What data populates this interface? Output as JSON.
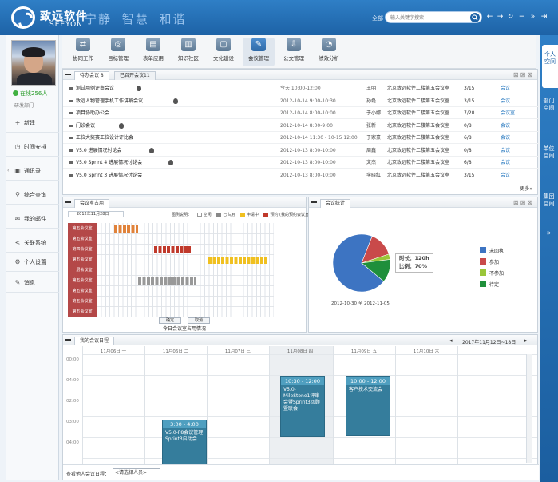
{
  "header": {
    "brand_cn": "致远软件",
    "brand_en": "SEEYON",
    "slogan": "宁静 智慧 和谐",
    "search_label": "全部",
    "search_placeholder": "输入关键字搜索"
  },
  "sidebar": {
    "online_text": "在线256人",
    "dept_text": "研发部门",
    "items": [
      {
        "icon": "plus-icon",
        "label": "新建"
      },
      {
        "icon": "clock-icon",
        "label": "时间安排"
      },
      {
        "icon": "contacts-icon",
        "label": "通讯录"
      },
      {
        "icon": "search-icon",
        "label": "综合查询"
      },
      {
        "icon": "mail-icon",
        "label": "我的邮件"
      },
      {
        "icon": "share-icon",
        "label": "关联系统"
      },
      {
        "icon": "settings-icon",
        "label": "个人设置"
      },
      {
        "icon": "message-icon",
        "label": "消息"
      }
    ]
  },
  "toolbar": {
    "items": [
      {
        "icon": "collaboration-icon",
        "label": "协同工作"
      },
      {
        "icon": "target-icon",
        "label": "目标管理"
      },
      {
        "icon": "form-icon",
        "label": "表单应用"
      },
      {
        "icon": "book-icon",
        "label": "知识社区"
      },
      {
        "icon": "clipboard-icon",
        "label": "文化建设"
      },
      {
        "icon": "meeting-icon",
        "label": "会议管理"
      },
      {
        "icon": "document-icon",
        "label": "公文管理"
      },
      {
        "icon": "analysis-icon",
        "label": "绩效分析"
      }
    ]
  },
  "vtabs": {
    "items": [
      "个人空间",
      "部门空间",
      "单位空间",
      "集团空间"
    ],
    "more": "»"
  },
  "meetings": {
    "tabs": [
      "待办会议 8",
      "已召开会议11"
    ],
    "rows": [
      {
        "title": "测试用例评审会议",
        "time": "今天 10:00-12:00",
        "host": "王明",
        "room": "北京致远软件二楼第五会议室",
        "count": "3/15",
        "type": "会议"
      },
      {
        "title": "致远人物管理手机工作讲解会议",
        "time": "2012-10-14 9:00-10:30",
        "host": "孙磊",
        "room": "北京致远软件二楼第五会议室",
        "count": "3/15",
        "type": "会议"
      },
      {
        "title": "项目协助办公会",
        "time": "2012-10-14 8:00-10:00",
        "host": "于小娜",
        "room": "北京致远软件二楼第五会议室",
        "count": "7/20",
        "type": "会议室"
      },
      {
        "title": "门诊会议",
        "time": "2012-10-14 8:00-9:00",
        "host": "张新",
        "room": "北京致远软件二楼第五会议室",
        "count": "0/8",
        "type": "会议"
      },
      {
        "title": "工位大奖赛工位设计评比会",
        "time": "2012-10-14 11:30 - 10-15 12:00",
        "host": "于家豪",
        "room": "北京致远软件二楼第五会议室",
        "count": "6/8",
        "type": "会议"
      },
      {
        "title": "V5.0 进展情况讨论会",
        "time": "2012-10-13 8:00-10:00",
        "host": "周鑫",
        "room": "北京致远软件二楼第五会议室",
        "count": "0/8",
        "type": "会议"
      },
      {
        "title": "V5.0 Sprint 4 进展情况讨论会",
        "time": "2012-10-13 8:00-10:00",
        "host": "文杰",
        "room": "北京致远软件二楼第五会议室",
        "count": "6/8",
        "type": "会议"
      },
      {
        "title": "V5.0 Sprint 3 进展情况讨论会",
        "time": "2012-10-13 8:00-10:00",
        "host": "李晓红",
        "room": "北京致远软件二楼第五会议室",
        "count": "3/15",
        "type": "会议"
      }
    ],
    "more": "更多»"
  },
  "room_booking": {
    "tab": "会议室占用",
    "date": "2012年11月28日",
    "legend": {
      "prefix": "图例说明：",
      "items": [
        {
          "label": "空闲",
          "color": "#ffffff"
        },
        {
          "label": "已占用",
          "color": "#888888"
        },
        {
          "label": "申请中",
          "color": "#f0c020"
        },
        {
          "label": "预约",
          "color": "#c0392b"
        }
      ],
      "suffix": "(我的预约会议室占用)"
    },
    "rooms": [
      "第五会议室",
      "第五会议室",
      "第四会议室",
      "第五会议室",
      "一层会议室",
      "第五会议室",
      "第五会议室",
      "第五会议室",
      "第五会议室"
    ],
    "confirm_label": "确定",
    "cancel_label": "取消",
    "footer": "今日会议室占用情况"
  },
  "stats": {
    "tab": "会议统计",
    "tooltip_line1": "时长：120h",
    "tooltip_line2": "比例：70%",
    "date_range": "2012-10-30 至 2012-11-05",
    "chart_data": {
      "type": "pie",
      "categories": [
        "未回执",
        "参加",
        "不参加",
        "待定"
      ],
      "values": [
        70,
        14,
        3,
        13
      ],
      "colors": [
        "#3d74c2",
        "#c94a4a",
        "#9ac63a",
        "#1f8f3b"
      ]
    }
  },
  "calendar": {
    "tab": "我的会议日程",
    "range": "2017年11月12日~18日",
    "days": [
      "11月06日 一",
      "11月06日 二",
      "11月07日 三",
      "11月08日 四",
      "11月09日 五",
      "11月10日 六"
    ],
    "times": [
      "00:00",
      "04:00",
      "02:00",
      "03:00",
      "04:00"
    ],
    "events": [
      {
        "time": "3:00 - 4:00",
        "title": "V5.0-P8会议管理 Sprint3启动会"
      },
      {
        "time": "10:30 - 12:00",
        "title": "V5.0-MileStone1评审会暨Sprint3回顾暨联会"
      },
      {
        "time": "10:00 - 12:00",
        "title": "客户技术交流会"
      }
    ],
    "footer_label": "查看他人会议日程：",
    "footer_value": "<请选择人员>"
  }
}
